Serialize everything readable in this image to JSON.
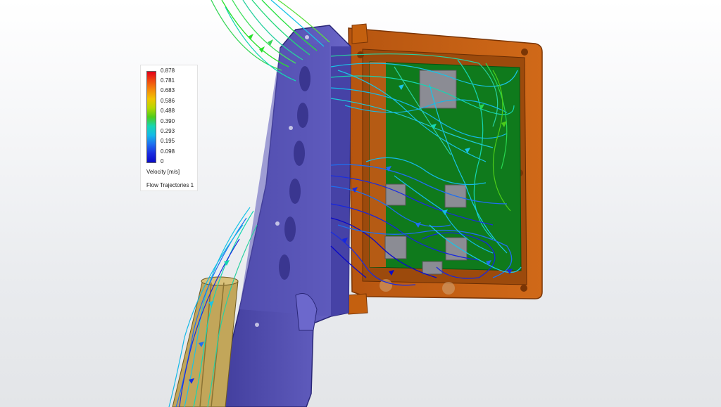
{
  "legend": {
    "ticks": [
      "0.878",
      "0.781",
      "0.683",
      "0.586",
      "0.488",
      "0.390",
      "0.293",
      "0.195",
      "0.098",
      "0"
    ],
    "title": "Velocity [m/s]",
    "caption": "Flow Trajectories 1"
  },
  "colors": {
    "housing_orange": "#c55f12",
    "housing_orange_dark": "#8a3d08",
    "lid_purple": "#5a56b8",
    "lid_purple_dark": "#34318a",
    "pcb_green": "#0f7a1c",
    "chip_gray": "#8b8c94",
    "flow_slow": "#1626e0",
    "flow_mid": "#19c4e6",
    "flow_fast": "#28e02a"
  },
  "icons": {
    "flow_arrow": "triangle-arrowhead"
  }
}
